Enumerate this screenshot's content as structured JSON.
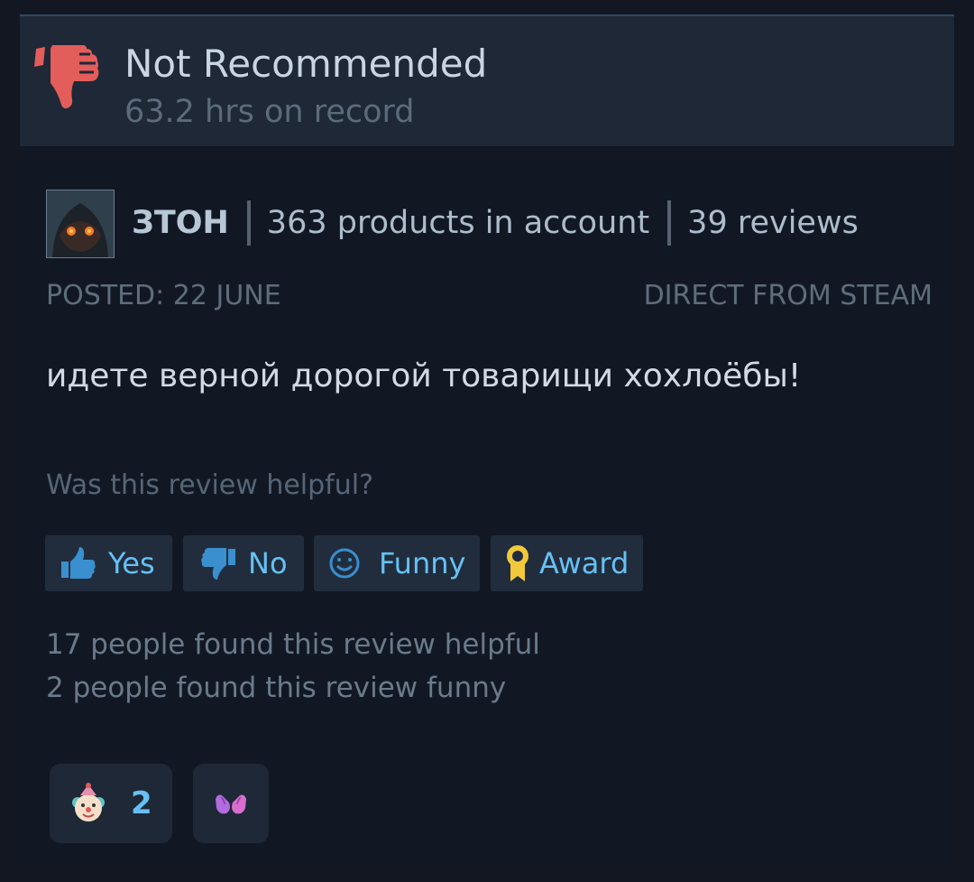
{
  "review": {
    "verdict": "Not Recommended",
    "hours": "63.2 hrs on record",
    "author": {
      "name": "ЗТОН",
      "products": "363 products in account",
      "reviews": "39 reviews"
    },
    "posted": "POSTED: 22 JUNE",
    "source": "DIRECT FROM STEAM",
    "text": "идете верной дорогой товарищи хохлоёбы!"
  },
  "helpful": {
    "question": "Was this review helpful?",
    "buttons": {
      "yes": "Yes",
      "no": "No",
      "funny": "Funny",
      "award": "Award"
    },
    "helpful_count": "17 people found this review helpful",
    "funny_count": "2 people found this review funny"
  },
  "reactions": [
    {
      "icon": "clown-face-icon",
      "count": "2"
    },
    {
      "icon": "mittens-icon"
    }
  ],
  "colors": {
    "accent": "#66c0f4",
    "thumb_down": "#e35d5b",
    "award": "#f3c93c"
  }
}
